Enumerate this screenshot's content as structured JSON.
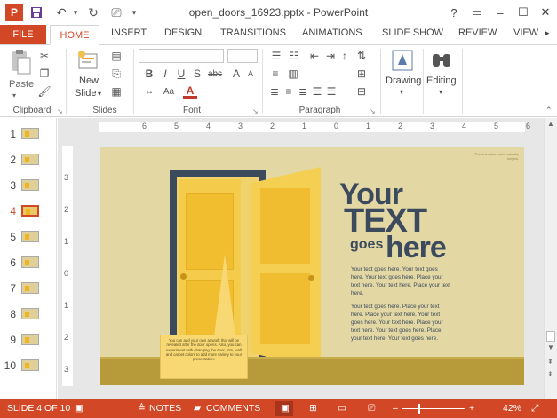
{
  "window": {
    "title": "open_doors_16923.pptx - PowerPoint",
    "app_logo": "P",
    "help": "?",
    "controls": {
      "restore": "▭",
      "minimize": "–",
      "maximize": "☐",
      "close": "✕"
    }
  },
  "quick_access": {
    "save_icon": "save-icon",
    "undo_icon": "undo-icon",
    "redo_icon": "redo-icon",
    "present_icon": "present-icon",
    "more_icon": "customize-icon"
  },
  "tabs": {
    "file": "FILE",
    "home": "HOME",
    "insert": "INSERT",
    "design": "DESIGN",
    "transitions": "TRANSITIONS",
    "animations": "ANIMATIONS",
    "slide_show": "SLIDE SHOW",
    "review": "REVIEW",
    "view": "VIEW"
  },
  "ribbon": {
    "clipboard": {
      "label": "Clipboard",
      "paste": "Paste"
    },
    "slides": {
      "label": "Slides",
      "new_slide_1": "New",
      "new_slide_2": "Slide"
    },
    "font": {
      "label": "Font",
      "bold": "B",
      "italic": "I",
      "underline": "U",
      "strike": "S",
      "abc": "abc",
      "aa": "Aa"
    },
    "paragraph": {
      "label": "Paragraph"
    },
    "drawing": {
      "label": "Drawing"
    },
    "editing": {
      "label": "Editing"
    }
  },
  "thumbnails": [
    "1",
    "2",
    "3",
    "4",
    "5",
    "6",
    "7",
    "8",
    "9",
    "10"
  ],
  "selected_slide": 4,
  "slide": {
    "note": "The animation automatically begins.",
    "headline_your": "Your",
    "headline_text": "TEXT",
    "headline_goes": "goes",
    "headline_here": "here",
    "para1": "Your text goes here. Your text goes here. Your text goes here. Place your text here. Your text here. Place your text here.",
    "para2": "Your text goes here. Place your text here. Place your text here. Your text goes here. Your text here. Place your text here. Your text goes here. Place your text here. Your text goes here.",
    "callout": "You can add your own artwork that will be revealed after the door opens. Also, you can experiment with changing the door, trim, wall and carpet colors to add more variety to your presentation."
  },
  "ruler_labels": [
    "6",
    "5",
    "4",
    "3",
    "2",
    "1",
    "0",
    "1",
    "2",
    "3",
    "4",
    "5",
    "6"
  ],
  "vruler_labels": [
    "3",
    "2",
    "1",
    "0",
    "1",
    "2",
    "3"
  ],
  "status": {
    "slide_of": "SLIDE 4 OF 10",
    "notes": "NOTES",
    "comments": "COMMENTS",
    "zoom": "42%"
  },
  "colors": {
    "accent": "#d24726",
    "slide_wall": "#e3d7a4",
    "door": "#f4cb4a",
    "frame": "#3b4a5c"
  }
}
